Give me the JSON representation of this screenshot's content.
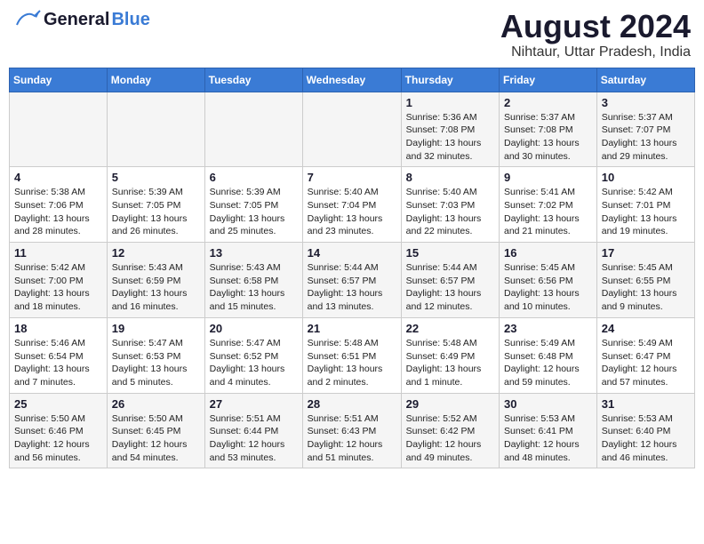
{
  "header": {
    "logo_text_general": "General",
    "logo_text_blue": "Blue",
    "title": "August 2024",
    "subtitle": "Nihtaur, Uttar Pradesh, India"
  },
  "days_of_week": [
    "Sunday",
    "Monday",
    "Tuesday",
    "Wednesday",
    "Thursday",
    "Friday",
    "Saturday"
  ],
  "weeks": [
    [
      {
        "day": "",
        "info": ""
      },
      {
        "day": "",
        "info": ""
      },
      {
        "day": "",
        "info": ""
      },
      {
        "day": "",
        "info": ""
      },
      {
        "day": "1",
        "info": "Sunrise: 5:36 AM\nSunset: 7:08 PM\nDaylight: 13 hours\nand 32 minutes."
      },
      {
        "day": "2",
        "info": "Sunrise: 5:37 AM\nSunset: 7:08 PM\nDaylight: 13 hours\nand 30 minutes."
      },
      {
        "day": "3",
        "info": "Sunrise: 5:37 AM\nSunset: 7:07 PM\nDaylight: 13 hours\nand 29 minutes."
      }
    ],
    [
      {
        "day": "4",
        "info": "Sunrise: 5:38 AM\nSunset: 7:06 PM\nDaylight: 13 hours\nand 28 minutes."
      },
      {
        "day": "5",
        "info": "Sunrise: 5:39 AM\nSunset: 7:05 PM\nDaylight: 13 hours\nand 26 minutes."
      },
      {
        "day": "6",
        "info": "Sunrise: 5:39 AM\nSunset: 7:05 PM\nDaylight: 13 hours\nand 25 minutes."
      },
      {
        "day": "7",
        "info": "Sunrise: 5:40 AM\nSunset: 7:04 PM\nDaylight: 13 hours\nand 23 minutes."
      },
      {
        "day": "8",
        "info": "Sunrise: 5:40 AM\nSunset: 7:03 PM\nDaylight: 13 hours\nand 22 minutes."
      },
      {
        "day": "9",
        "info": "Sunrise: 5:41 AM\nSunset: 7:02 PM\nDaylight: 13 hours\nand 21 minutes."
      },
      {
        "day": "10",
        "info": "Sunrise: 5:42 AM\nSunset: 7:01 PM\nDaylight: 13 hours\nand 19 minutes."
      }
    ],
    [
      {
        "day": "11",
        "info": "Sunrise: 5:42 AM\nSunset: 7:00 PM\nDaylight: 13 hours\nand 18 minutes."
      },
      {
        "day": "12",
        "info": "Sunrise: 5:43 AM\nSunset: 6:59 PM\nDaylight: 13 hours\nand 16 minutes."
      },
      {
        "day": "13",
        "info": "Sunrise: 5:43 AM\nSunset: 6:58 PM\nDaylight: 13 hours\nand 15 minutes."
      },
      {
        "day": "14",
        "info": "Sunrise: 5:44 AM\nSunset: 6:57 PM\nDaylight: 13 hours\nand 13 minutes."
      },
      {
        "day": "15",
        "info": "Sunrise: 5:44 AM\nSunset: 6:57 PM\nDaylight: 13 hours\nand 12 minutes."
      },
      {
        "day": "16",
        "info": "Sunrise: 5:45 AM\nSunset: 6:56 PM\nDaylight: 13 hours\nand 10 minutes."
      },
      {
        "day": "17",
        "info": "Sunrise: 5:45 AM\nSunset: 6:55 PM\nDaylight: 13 hours\nand 9 minutes."
      }
    ],
    [
      {
        "day": "18",
        "info": "Sunrise: 5:46 AM\nSunset: 6:54 PM\nDaylight: 13 hours\nand 7 minutes."
      },
      {
        "day": "19",
        "info": "Sunrise: 5:47 AM\nSunset: 6:53 PM\nDaylight: 13 hours\nand 5 minutes."
      },
      {
        "day": "20",
        "info": "Sunrise: 5:47 AM\nSunset: 6:52 PM\nDaylight: 13 hours\nand 4 minutes."
      },
      {
        "day": "21",
        "info": "Sunrise: 5:48 AM\nSunset: 6:51 PM\nDaylight: 13 hours\nand 2 minutes."
      },
      {
        "day": "22",
        "info": "Sunrise: 5:48 AM\nSunset: 6:49 PM\nDaylight: 13 hours\nand 1 minute."
      },
      {
        "day": "23",
        "info": "Sunrise: 5:49 AM\nSunset: 6:48 PM\nDaylight: 12 hours\nand 59 minutes."
      },
      {
        "day": "24",
        "info": "Sunrise: 5:49 AM\nSunset: 6:47 PM\nDaylight: 12 hours\nand 57 minutes."
      }
    ],
    [
      {
        "day": "25",
        "info": "Sunrise: 5:50 AM\nSunset: 6:46 PM\nDaylight: 12 hours\nand 56 minutes."
      },
      {
        "day": "26",
        "info": "Sunrise: 5:50 AM\nSunset: 6:45 PM\nDaylight: 12 hours\nand 54 minutes."
      },
      {
        "day": "27",
        "info": "Sunrise: 5:51 AM\nSunset: 6:44 PM\nDaylight: 12 hours\nand 53 minutes."
      },
      {
        "day": "28",
        "info": "Sunrise: 5:51 AM\nSunset: 6:43 PM\nDaylight: 12 hours\nand 51 minutes."
      },
      {
        "day": "29",
        "info": "Sunrise: 5:52 AM\nSunset: 6:42 PM\nDaylight: 12 hours\nand 49 minutes."
      },
      {
        "day": "30",
        "info": "Sunrise: 5:53 AM\nSunset: 6:41 PM\nDaylight: 12 hours\nand 48 minutes."
      },
      {
        "day": "31",
        "info": "Sunrise: 5:53 AM\nSunset: 6:40 PM\nDaylight: 12 hours\nand 46 minutes."
      }
    ]
  ]
}
